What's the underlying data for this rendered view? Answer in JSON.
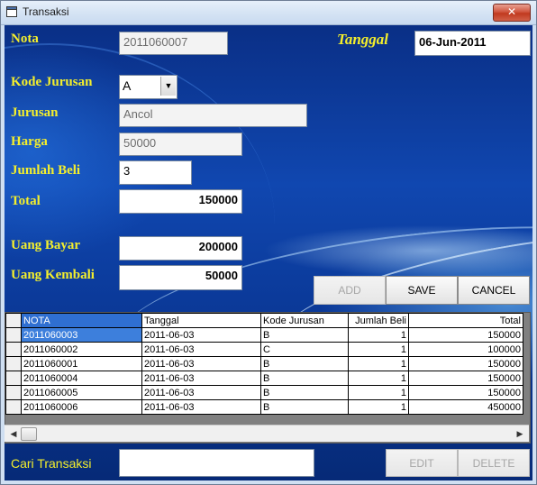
{
  "window": {
    "title": "Transaksi",
    "close_glyph": "✕"
  },
  "form": {
    "nota_label": "Nota",
    "nota_value": "2011060007",
    "tanggal_label": "Tanggal",
    "tanggal_value": "06-Jun-2011",
    "kode_jurusan_label": "Kode Jurusan",
    "kode_jurusan_value": "A",
    "jurusan_label": "Jurusan",
    "jurusan_value": "Ancol",
    "harga_label": "Harga",
    "harga_value": "50000",
    "jumlah_beli_label": "Jumlah Beli",
    "jumlah_beli_value": "3",
    "total_label": "Total",
    "total_value": "150000",
    "uang_bayar_label": "Uang Bayar",
    "uang_bayar_value": "200000",
    "uang_kembali_label": "Uang Kembali",
    "uang_kembali_value": "50000"
  },
  "buttons": {
    "add": "ADD",
    "save": "SAVE",
    "cancel": "CANCEL",
    "edit": "EDIT",
    "delete": "DELETE"
  },
  "grid": {
    "columns": [
      "NOTA",
      "Tanggal",
      "Kode Jurusan",
      "Jumlah Beli",
      "Total"
    ],
    "rows": [
      [
        "2011060003",
        "2011-06-03",
        "B",
        "1",
        "150000"
      ],
      [
        "2011060002",
        "2011-06-03",
        "C",
        "1",
        "100000"
      ],
      [
        "2011060001",
        "2011-06-03",
        "B",
        "1",
        "150000"
      ],
      [
        "2011060004",
        "2011-06-03",
        "B",
        "1",
        "150000"
      ],
      [
        "2011060005",
        "2011-06-03",
        "B",
        "1",
        "150000"
      ],
      [
        "2011060006",
        "2011-06-03",
        "B",
        "1",
        "450000"
      ]
    ]
  },
  "search": {
    "label": "Cari Transaksi",
    "value": ""
  },
  "icons": {
    "window": "window-icon",
    "dropdown": "chevron-down-icon",
    "scroll_left": "arrow-left-icon",
    "scroll_right": "arrow-right-icon"
  },
  "colors": {
    "label_yellow": "#f4ef2c",
    "background_blue": "#0b3a9a",
    "selected_blue": "#3d7fdc"
  }
}
